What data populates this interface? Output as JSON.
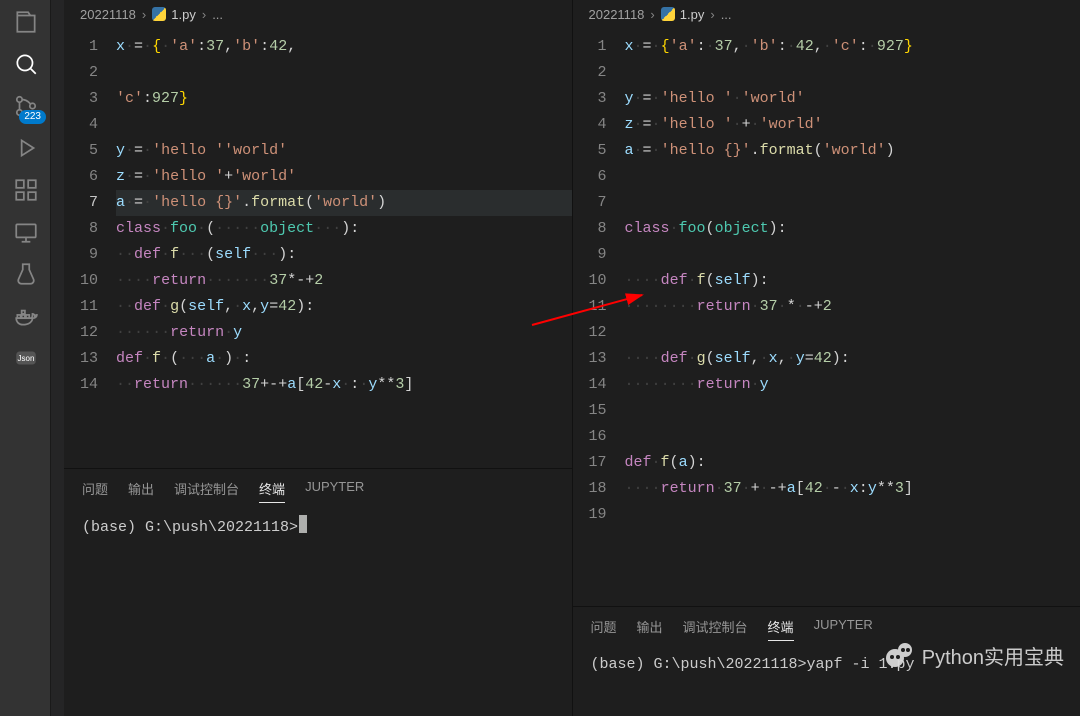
{
  "activity": {
    "source_badge": "223"
  },
  "left": {
    "breadcrumbs": {
      "folder": "20221118",
      "file": "1.py",
      "trail": "..."
    },
    "current_line": 7,
    "lines": [
      "x = { 'a':37,'b':42,",
      "",
      "'c':927}",
      "",
      "y = 'hello ''world'",
      "z = 'hello '+'world'",
      "a = 'hello {}'.format('world')",
      "class foo (     object   ):",
      "  def f   (self   ):",
      "    return       37*-+2",
      "  def g(self, x,y=42):",
      "      return y",
      "def f (   a ) :",
      "  return      37+-+a[42-x : y**3]"
    ],
    "panel": {
      "tabs": [
        "问题",
        "输出",
        "调试控制台",
        "终端",
        "JUPYTER"
      ],
      "active": 3,
      "terminal": "(base) G:\\push\\20221118>"
    }
  },
  "right": {
    "breadcrumbs": {
      "folder": "20221118",
      "file": "1.py",
      "trail": "..."
    },
    "lines": [
      "x = {'a': 37, 'b': 42, 'c': 927}",
      "",
      "y = 'hello ' 'world'",
      "z = 'hello ' + 'world'",
      "a = 'hello {}'.format('world')",
      "",
      "",
      "class foo(object):",
      "",
      "    def f(self):",
      "        return 37 * -+2",
      "",
      "    def g(self, x, y=42):",
      "        return y",
      "",
      "",
      "def f(a):",
      "    return 37 + -+a[42 - x:y**3]",
      ""
    ],
    "panel": {
      "tabs": [
        "问题",
        "输出",
        "调试控制台",
        "终端",
        "JUPYTER"
      ],
      "active": 3,
      "terminal": "(base) G:\\push\\20221118>yapf -i 1.py"
    }
  },
  "watermark": "Python实用宝典"
}
